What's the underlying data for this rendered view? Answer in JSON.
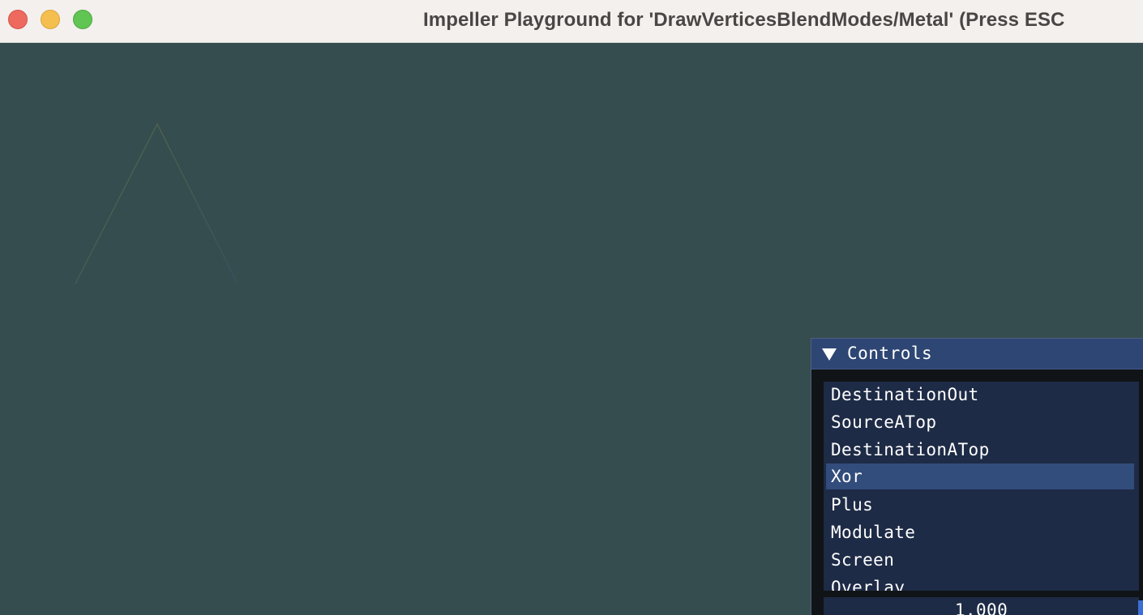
{
  "window": {
    "title": "Impeller Playground for 'DrawVerticesBlendModes/Metal' (Press ESC",
    "traffic_lights": [
      "close-button",
      "minimize-button",
      "maximize-button"
    ]
  },
  "canvas": {
    "background": "#364d4f",
    "triangle_stroke": "#5a6a4a"
  },
  "controls": {
    "title": "Controls",
    "collapse_icon": "triangle-down-icon",
    "blend_modes": [
      "DestinationOut",
      "SourceATop",
      "DestinationATop",
      "Xor",
      "Plus",
      "Modulate",
      "Screen",
      "Overlay"
    ],
    "selected_index": 3,
    "slider_value": "1.000"
  },
  "colors": {
    "panel_header": "#2e4673",
    "list_background": "#1e2b46",
    "list_selected": "#324c7c"
  }
}
